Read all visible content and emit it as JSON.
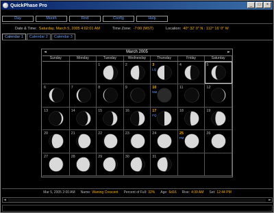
{
  "window": {
    "title": "QuickPhase Pro",
    "buttons": [
      "_",
      "□",
      "×"
    ]
  },
  "menu": [
    "Day",
    "Month",
    "Find",
    "Config",
    "Help"
  ],
  "info": {
    "date_label": "Date & Time:",
    "date_value": "Saturday, March 5, 2005  4:02:01 AM",
    "tz_label": "Time Zone:",
    "tz_value": "-7:00 (MST)",
    "loc_label": "Location:",
    "loc_value": "40° 32' 0\" N  :  112° 16' 0\" W"
  },
  "tabs": [
    "Calendar 1",
    "Calendar 2",
    "Calendar 3"
  ],
  "calendar": {
    "month": "March 2005",
    "prev_arrow": "◄",
    "next_arrow": "►",
    "weekdays": [
      "Sunday",
      "Monday",
      "Tuesday",
      "Wednesday",
      "Thursday",
      "Friday",
      "Saturday"
    ],
    "weeks": [
      [
        null,
        null,
        {
          "d": "1",
          "ill": 0.72,
          "wax": false
        },
        {
          "d": "2",
          "ill": 0.61,
          "wax": false
        },
        {
          "d": "3",
          "ill": 0.5,
          "wax": false,
          "tag": "LQ",
          "hl": true
        },
        {
          "d": "4",
          "ill": 0.39,
          "wax": false
        },
        {
          "d": "5",
          "ill": 0.29,
          "wax": false,
          "today": true
        }
      ],
      [
        {
          "d": "6",
          "ill": 0.2,
          "wax": false
        },
        {
          "d": "7",
          "ill": 0.12,
          "wax": false
        },
        {
          "d": "8",
          "ill": 0.06,
          "wax": false
        },
        {
          "d": "9",
          "ill": 0.02,
          "wax": false
        },
        {
          "d": "10",
          "ill": 0.0,
          "wax": true,
          "tag": "NM",
          "hl": true
        },
        {
          "d": "11",
          "ill": 0.02,
          "wax": true
        },
        {
          "d": "12",
          "ill": 0.06,
          "wax": true
        }
      ],
      [
        {
          "d": "13",
          "ill": 0.12,
          "wax": true
        },
        {
          "d": "14",
          "ill": 0.2,
          "wax": true
        },
        {
          "d": "15",
          "ill": 0.29,
          "wax": true
        },
        {
          "d": "16",
          "ill": 0.39,
          "wax": true
        },
        {
          "d": "17",
          "ill": 0.5,
          "wax": true,
          "tag": "FQ",
          "hl": true
        },
        {
          "d": "18",
          "ill": 0.61,
          "wax": true
        },
        {
          "d": "19",
          "ill": 0.72,
          "wax": true
        }
      ],
      [
        {
          "d": "20",
          "ill": 0.8,
          "wax": true
        },
        {
          "d": "21",
          "ill": 0.87,
          "wax": true
        },
        {
          "d": "22",
          "ill": 0.93,
          "wax": true
        },
        {
          "d": "23",
          "ill": 0.97,
          "wax": true
        },
        {
          "d": "24",
          "ill": 0.99,
          "wax": true
        },
        {
          "d": "25",
          "ill": 1.0,
          "wax": true,
          "tag": "FM",
          "hl": true
        },
        {
          "d": "26",
          "ill": 0.99,
          "wax": false
        }
      ],
      [
        {
          "d": "27",
          "ill": 0.97,
          "wax": false
        },
        {
          "d": "28",
          "ill": 0.93,
          "wax": false
        },
        {
          "d": "29",
          "ill": 0.87,
          "wax": false
        },
        {
          "d": "30",
          "ill": 0.8,
          "wax": false
        },
        {
          "d": "31",
          "ill": 0.72,
          "wax": false
        },
        null,
        null
      ]
    ]
  },
  "status": {
    "datetime": "Mar 5, 2005 2:00 AM",
    "name_label": "Name:",
    "name_value": "Waning Crescent",
    "pct_label": "Percent of Full:",
    "pct_value": "32%",
    "age_label": "Age:",
    "age_value": "6d16",
    "rise_label": "Rise:",
    "rise_value": "4:39 AM",
    "set_label": "Set:",
    "set_value": "12:44 PM"
  },
  "colors": {
    "accent": "#ffb400",
    "link": "#6aa0ff",
    "title_bar": "#0a246a"
  }
}
